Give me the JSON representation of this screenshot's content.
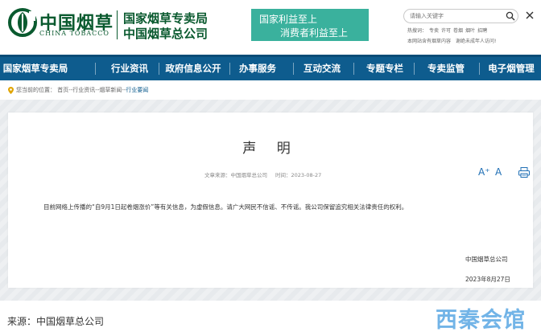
{
  "header": {
    "logo_cn": "中国烟草",
    "logo_en": "CHINA TOBACCO",
    "org_name_1": "国家烟草专卖局",
    "org_name_2": "中国烟草总公司",
    "banner_line1": "国家利益至上",
    "banner_line2": "消费者利益至上",
    "search_placeholder": "请输入关键字",
    "hot_label": "热搜词：",
    "hot_words": [
      "专卖",
      "许可",
      "卷烟",
      "烟叶",
      "招聘"
    ],
    "notice": "本网站含有烟草内容　谢绝未成年人访问!"
  },
  "nav": {
    "items": [
      "国家烟草专卖局",
      "行业资讯",
      "政府信息公开",
      "办事服务",
      "互动交流",
      "专题专栏",
      "专卖监管",
      "电子烟管理"
    ]
  },
  "breadcrumb": {
    "prefix": "您当前的位置：",
    "items": [
      "首页",
      "行业资讯",
      "烟草新闻",
      "行业要闻"
    ],
    "separator": "--"
  },
  "article": {
    "title": "声 明",
    "source_label": "文章来源：中国烟草总公司",
    "time_label": "时间：2023-08-27",
    "font_larger": "A⁺",
    "font_smaller": "A",
    "body": "目前网络上传播的“自9月1日起卷烟涨价”等有关信息，为虚假信息。请广大网民不信谣、不传谣。我公司保留追究相关法律责任的权利。",
    "signature_org": "中国烟草总公司",
    "signature_date": "2023年8月27日"
  },
  "footer": {
    "source": "来源：中国烟草总公司",
    "watermark": "西秦会馆"
  },
  "colors": {
    "brand_green": "#0a5a2f",
    "nav_blue": "#0e5c8e",
    "banner_teal": "#3ab19d",
    "link_blue": "#1f6fb5"
  }
}
